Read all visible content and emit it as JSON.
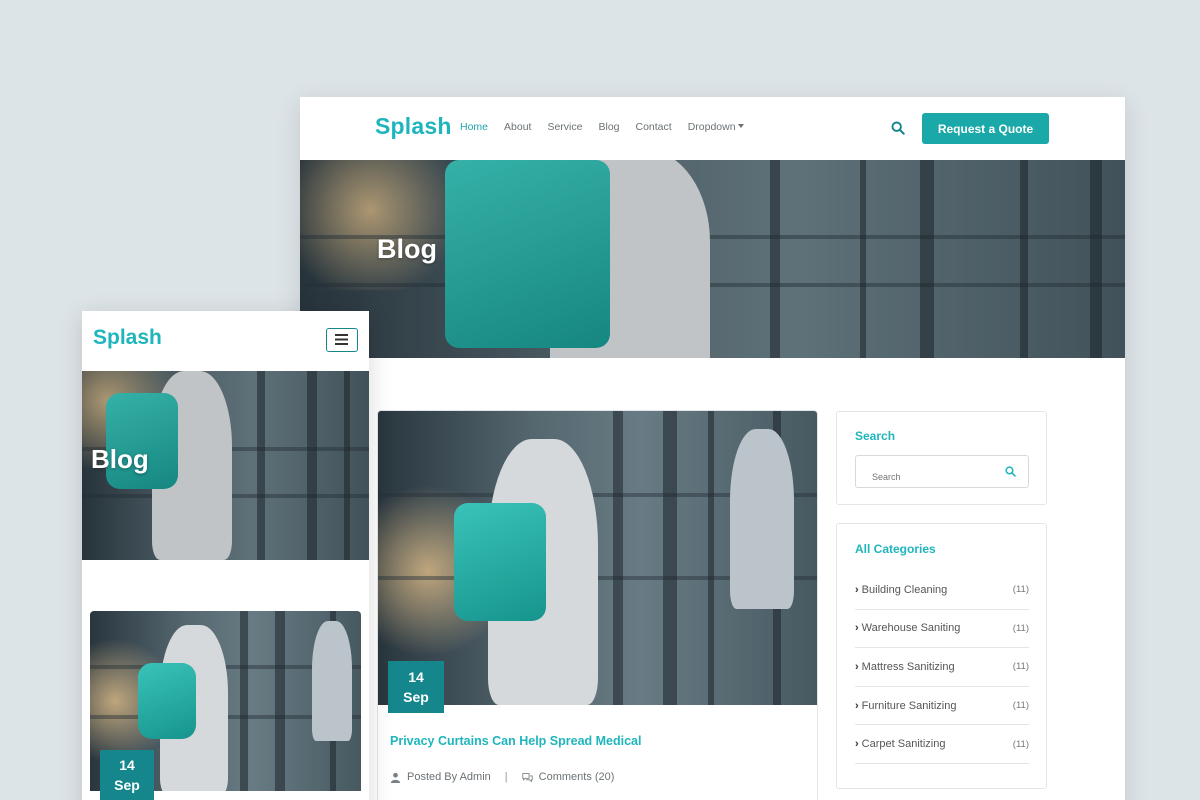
{
  "desktop": {
    "logo": "Splash",
    "nav": [
      {
        "label": "Home",
        "active": true
      },
      {
        "label": "About",
        "active": false
      },
      {
        "label": "Service",
        "active": false
      },
      {
        "label": "Blog",
        "active": false
      },
      {
        "label": "Contact",
        "active": false
      },
      {
        "label": "Dropdown",
        "active": false
      }
    ],
    "quote_button": "Request a Quote",
    "hero_title": "Blog",
    "post": {
      "day": "14",
      "month": "Sep",
      "title": "Privacy Curtains Can Help Spread Medical",
      "author": "Posted By Admin",
      "comments": "Comments (20)"
    },
    "sidebar": {
      "search_title": "Search",
      "search_placeholder": "Search",
      "categories_title": "All Categories",
      "categories": [
        {
          "name": "Building Cleaning",
          "count": "(11)"
        },
        {
          "name": "Warehouse Saniting",
          "count": "(11)"
        },
        {
          "name": "Mattress Sanitizing",
          "count": "(11)"
        },
        {
          "name": "Furniture Sanitizing",
          "count": "(11)"
        },
        {
          "name": "Carpet Sanitizing",
          "count": "(11)"
        }
      ]
    }
  },
  "mobile": {
    "logo": "Splash",
    "hero_title": "Blog",
    "post": {
      "day": "14",
      "month": "Sep"
    }
  },
  "colors": {
    "accent": "#1fb5bd",
    "button": "#1aa9a8",
    "badge": "#14868c",
    "background": "#dde4e8"
  },
  "icons": [
    "search-icon",
    "user-icon",
    "comments-icon",
    "menu-icon",
    "chevron-right-icon",
    "caret-down-icon"
  ]
}
